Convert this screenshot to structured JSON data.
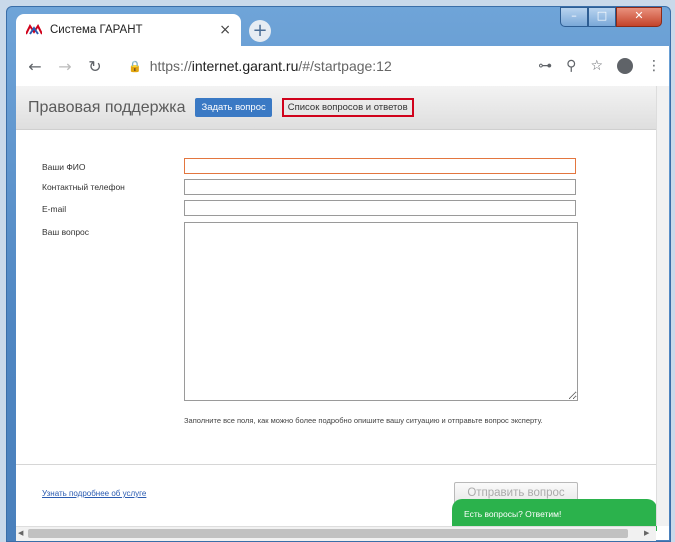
{
  "browser": {
    "tab_title": "Система ГАРАНТ",
    "tab_close_icon": "×",
    "new_tab_icon": "+",
    "url_prefix": "https://",
    "url_host": "internet.garant.ru",
    "url_path": "/#/startpage:12",
    "window_controls": {
      "minimize": "–",
      "maximize": "□",
      "close": "✕"
    },
    "nav": {
      "back": "←",
      "forward": "→",
      "reload": "↻"
    }
  },
  "page": {
    "brand": "Правовая поддержка",
    "ask_button": "Задать вопрос",
    "faq_link": "Список вопросов и ответов",
    "form": {
      "name_label": "Ваши ФИО",
      "name_value": "",
      "phone_label": "Контактный телефон",
      "phone_value": "",
      "email_label": "E-mail",
      "email_value": "",
      "question_label": "Ваш вопрос",
      "question_value": ""
    },
    "hint": "Заполните все поля, как можно более подробно опишите вашу ситуацию и отправьте вопрос эксперту.",
    "more_link": "Узнать подробнее об услуге",
    "submit_button": "Отправить вопрос",
    "chat_bubble": "Есть вопросы? Ответим!"
  },
  "colors": {
    "accent_blue": "#3a79c4",
    "highlight_red": "#d0021b",
    "chat_green": "#2bb24c"
  }
}
